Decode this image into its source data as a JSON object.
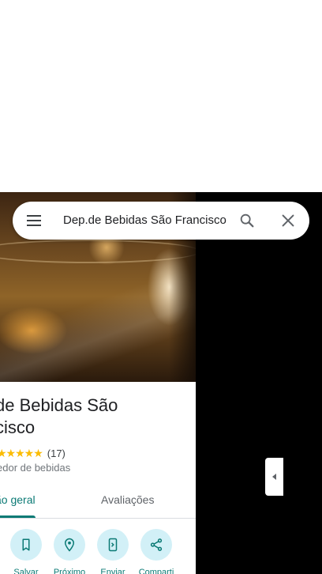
{
  "search": {
    "query": "Dep.de Bebidas São Francisco"
  },
  "place": {
    "title": "de Bebidas São\ncisco",
    "stars": "★★★★★",
    "rating_value": 4.5,
    "review_count": "(17)",
    "category": "edor de bebidas"
  },
  "tabs": [
    {
      "label": "ão geral",
      "active": true
    },
    {
      "label": "Avaliações",
      "active": false
    }
  ],
  "actions": [
    {
      "label": "Salvar",
      "icon": "bookmark-icon"
    },
    {
      "label": "Próximo",
      "icon": "nearby-icon"
    },
    {
      "label": "Enviar",
      "icon": "send-to-phone-icon"
    },
    {
      "label": "Comparti",
      "icon": "share-icon"
    }
  ],
  "colors": {
    "accent": "#0b7a75",
    "action_bg": "#d2f0f7",
    "star": "#fbbc04",
    "map_bg": "#000000"
  }
}
